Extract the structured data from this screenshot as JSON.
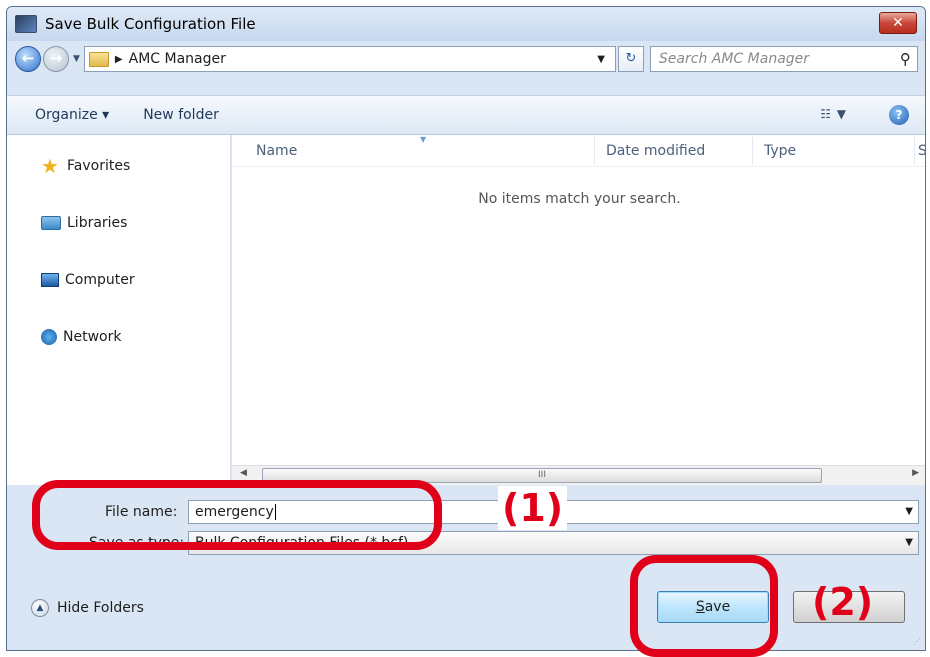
{
  "window": {
    "title": "Save Bulk Configuration File",
    "close_label": "✕"
  },
  "address": {
    "location": "AMC Manager",
    "search_placeholder": "Search AMC Manager"
  },
  "toolbar": {
    "organize": "Organize ▾",
    "new_folder": "New folder",
    "help": "?"
  },
  "sidebar": {
    "items": [
      {
        "label": "Favorites",
        "icon": "star-icon"
      },
      {
        "label": "Libraries",
        "icon": "libraries-icon"
      },
      {
        "label": "Computer",
        "icon": "computer-icon"
      },
      {
        "label": "Network",
        "icon": "network-icon"
      }
    ]
  },
  "file_list": {
    "columns": [
      "Name",
      "Date modified",
      "Type",
      "S"
    ],
    "empty_message": "No items match your search.",
    "scroll_grip": "III"
  },
  "form": {
    "file_name_label": "File name:",
    "file_name_value": "emergency",
    "save_as_type_label": "Save as type:",
    "save_as_type_value": "Bulk Configuration Files (*.bcf)"
  },
  "footer": {
    "hide_folders": "Hide Folders",
    "save_label": "Save",
    "save_accel": "S",
    "save_rest": "ave"
  },
  "annotations": {
    "step1": "(1)",
    "step2": "(2)",
    "color": "#e0001a"
  }
}
